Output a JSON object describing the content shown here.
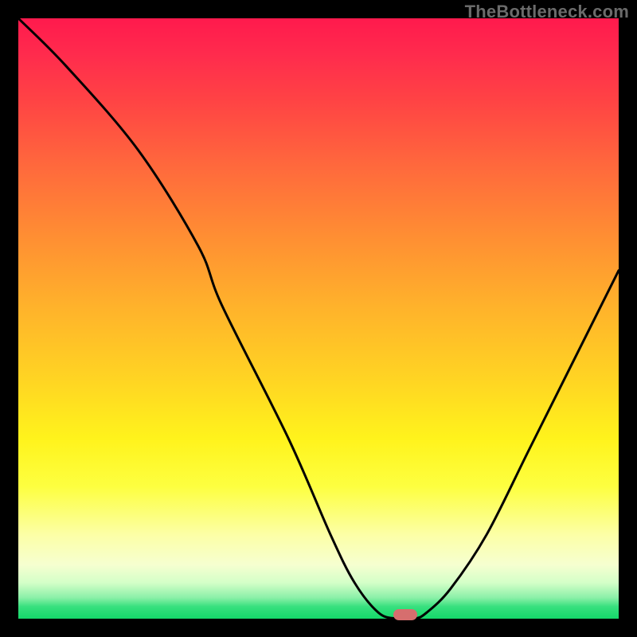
{
  "watermark": "TheBottleneck.com",
  "chart_data": {
    "type": "line",
    "title": "",
    "xlabel": "",
    "ylabel": "",
    "xlim": [
      0,
      100
    ],
    "ylim": [
      0,
      100
    ],
    "grid": false,
    "series": [
      {
        "name": "bottleneck-curve",
        "x": [
          0,
          8,
          20,
          30,
          34,
          45,
          52,
          56,
          60,
          63,
          66,
          68,
          72,
          78,
          85,
          92,
          100
        ],
        "values": [
          100,
          92,
          78,
          62,
          52,
          30,
          14,
          6,
          1,
          0,
          0,
          1,
          5,
          14,
          28,
          42,
          58
        ]
      }
    ],
    "marker": {
      "x": 64.5,
      "y": 0.7
    },
    "colors": {
      "curve": "#000000",
      "marker": "#d66e6e"
    }
  }
}
